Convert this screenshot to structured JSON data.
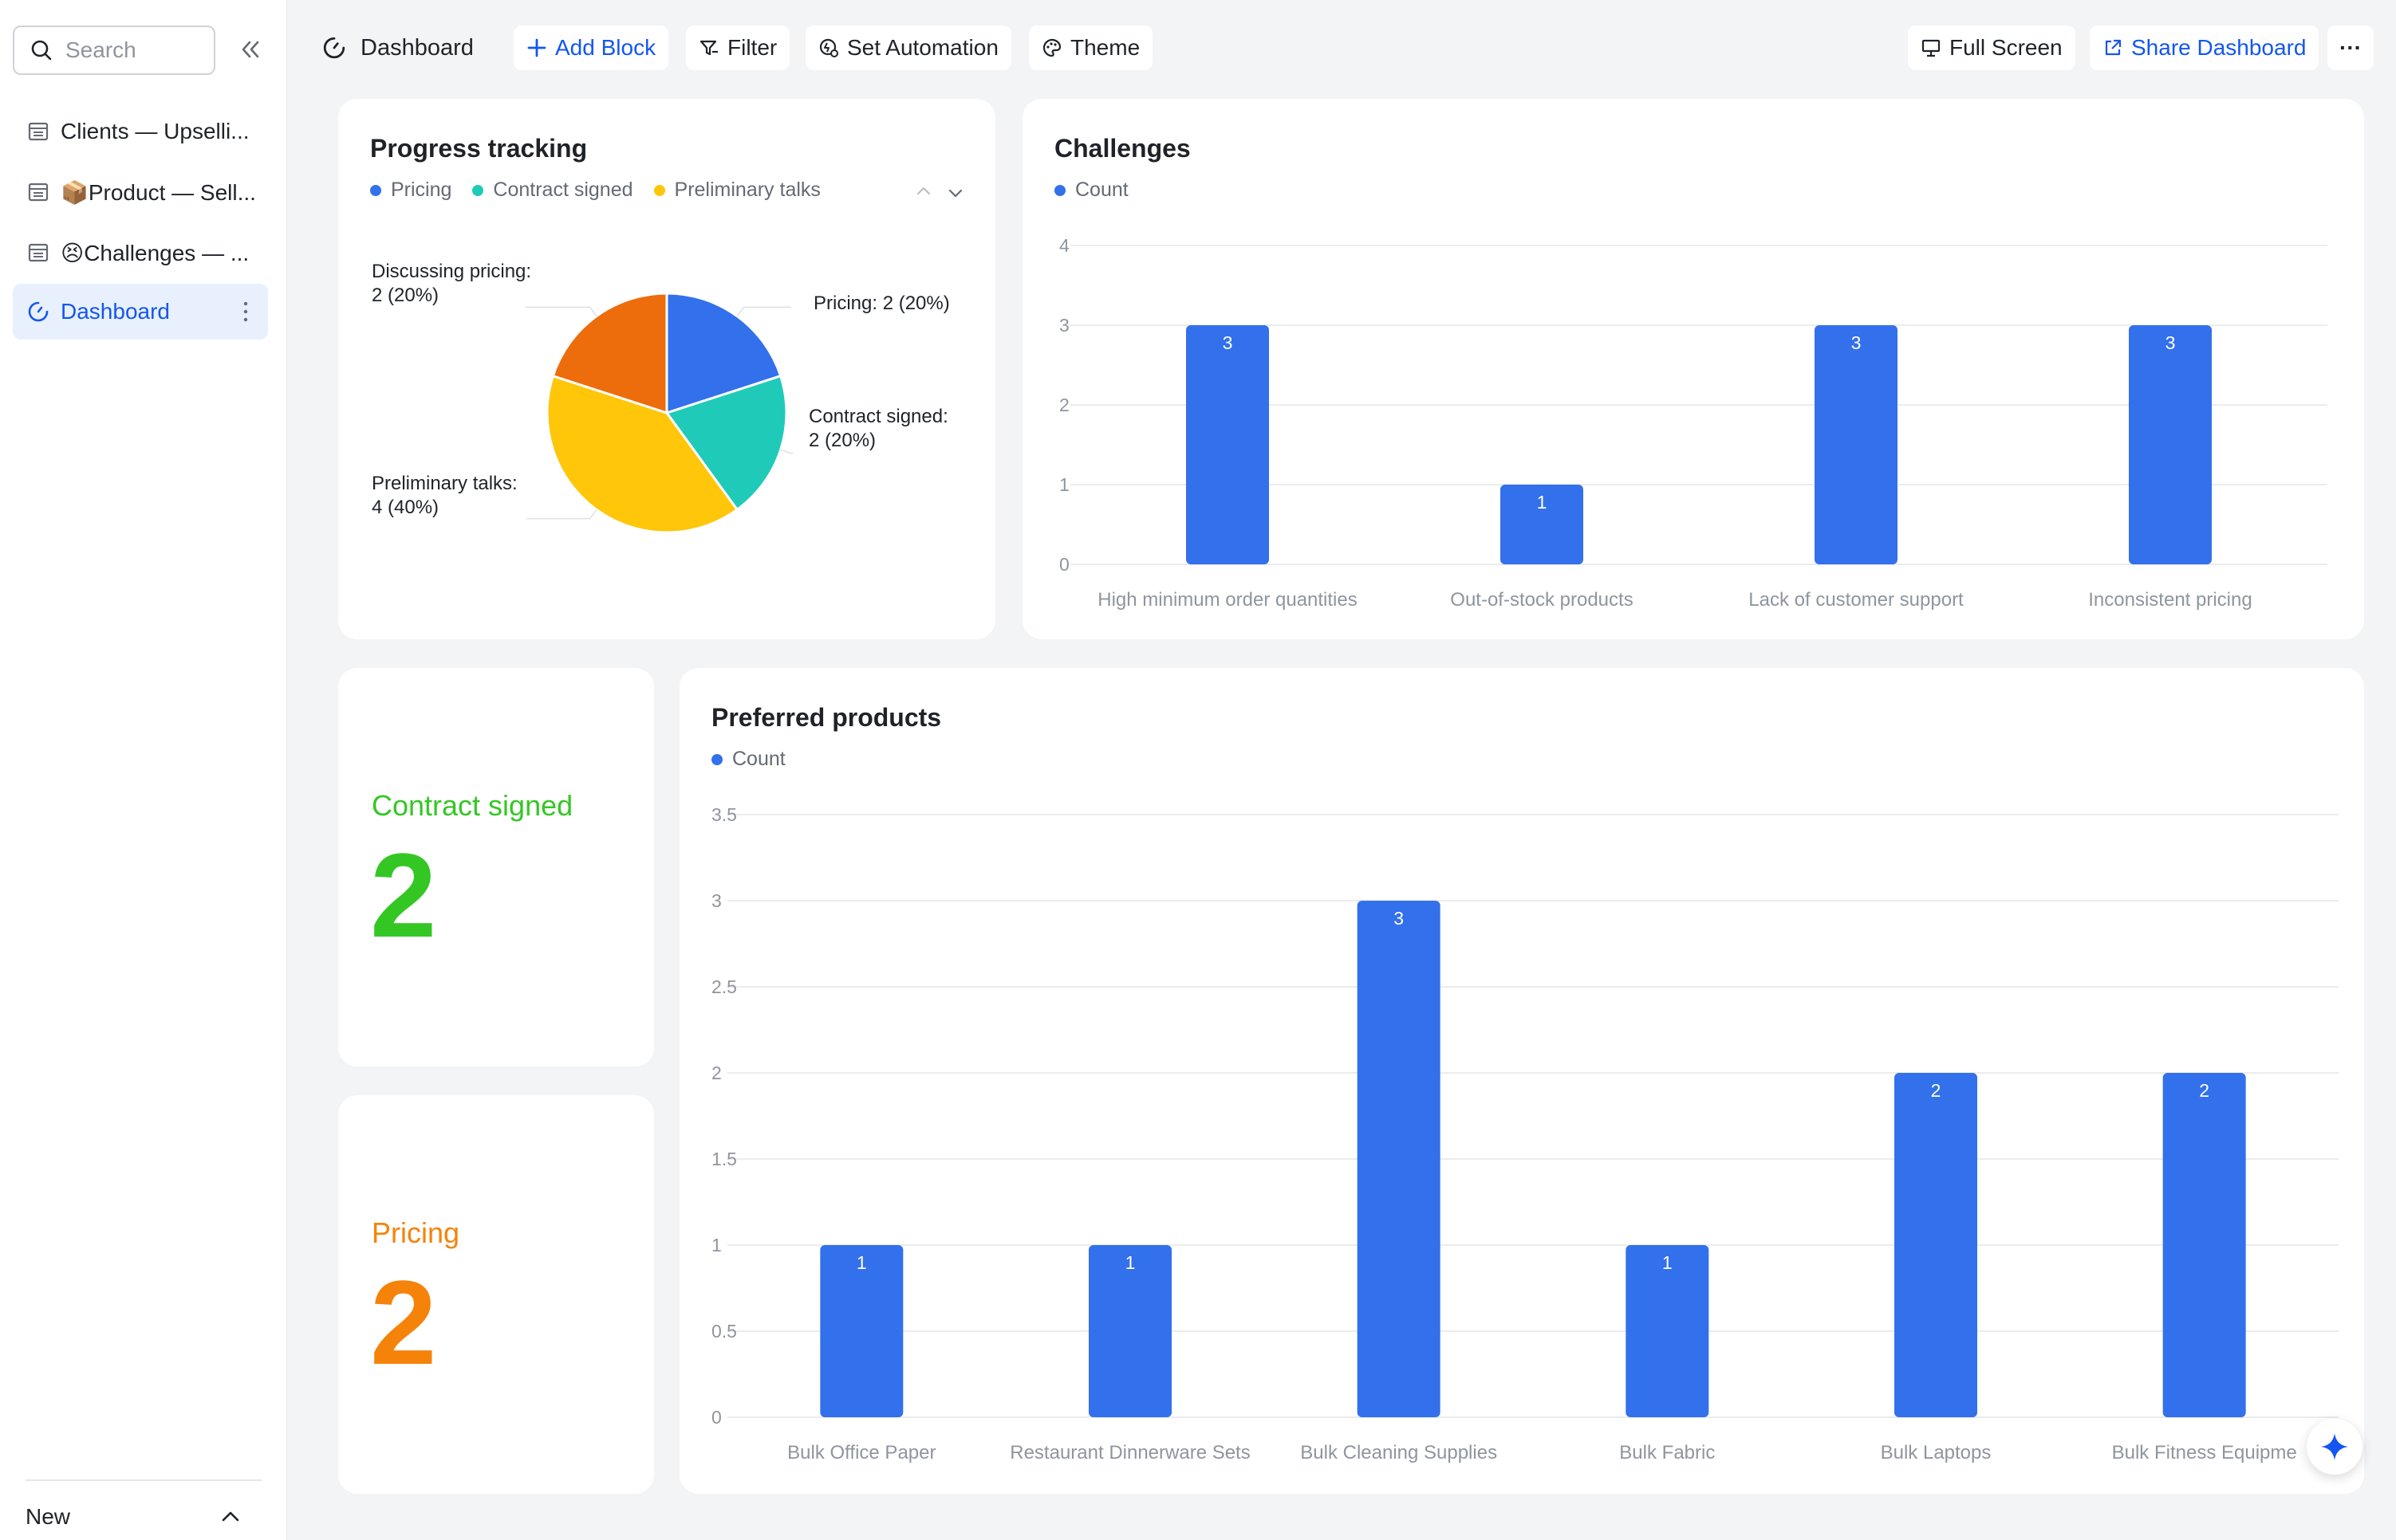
{
  "sidebar": {
    "search_placeholder": "Search",
    "items": [
      {
        "label": "Clients — Upselli..."
      },
      {
        "label": "📦Product — Sell..."
      },
      {
        "label": "😣Challenges — ..."
      },
      {
        "label": "Dashboard"
      }
    ],
    "footer_label": "New"
  },
  "toolbar": {
    "title": "Dashboard",
    "add_block": "Add Block",
    "filter": "Filter",
    "set_automation": "Set Automation",
    "theme": "Theme",
    "full_screen": "Full Screen",
    "share_dashboard": "Share Dashboard",
    "more": "···"
  },
  "colors": {
    "accent": "#1456f0",
    "bar": "#3370eb",
    "pricing": "#3370eb",
    "contract_signed": "#1fcbb8",
    "preliminary_talks": "#ffc60a",
    "discussing_pricing": "#ed6d0c",
    "kpi_green": "#34c724",
    "kpi_orange": "#f5830a"
  },
  "progress_tracking": {
    "title": "Progress tracking",
    "legend": [
      "Pricing",
      "Contract signed",
      "Preliminary talks"
    ]
  },
  "challenges": {
    "title": "Challenges",
    "legend": [
      "Count"
    ]
  },
  "kpi_contract": {
    "label": "Contract signed",
    "value": "2"
  },
  "kpi_pricing": {
    "label": "Pricing",
    "value": "2"
  },
  "preferred_products": {
    "title": "Preferred products",
    "legend": [
      "Count"
    ]
  },
  "chart_data": [
    {
      "type": "pie",
      "title": "Progress tracking",
      "slices": [
        {
          "name": "Pricing",
          "value": 2,
          "label": "Pricing: 2 (20%)",
          "color": "#3370eb"
        },
        {
          "name": "Contract signed",
          "value": 2,
          "label": "Contract signed: 2 (20%)",
          "color": "#1fcbb8"
        },
        {
          "name": "Preliminary talks",
          "value": 4,
          "label": "Preliminary talks: 4 (40%)",
          "color": "#ffc60a"
        },
        {
          "name": "Discussing pricing",
          "value": 2,
          "label": "Discussing pricing: 2 (20%)",
          "color": "#ed6d0c"
        }
      ]
    },
    {
      "type": "bar",
      "title": "Challenges",
      "categories": [
        "High minimum order quantities",
        "Out-of-stock products",
        "Lack of customer support",
        "Inconsistent pricing"
      ],
      "series": [
        {
          "name": "Count",
          "values": [
            3,
            1,
            3,
            3
          ]
        }
      ],
      "ylim": [
        0,
        4
      ],
      "yticks": [
        "0",
        "1",
        "2",
        "3",
        "4"
      ],
      "grid": true
    },
    {
      "type": "bar",
      "title": "Preferred products",
      "categories": [
        "Bulk Office Paper",
        "Restaurant Dinnerware Sets",
        "Bulk Cleaning Supplies",
        "Bulk Fabric",
        "Bulk Laptops",
        "Bulk Fitness Equipme"
      ],
      "series": [
        {
          "name": "Count",
          "values": [
            1,
            1,
            3,
            1,
            2,
            2
          ]
        }
      ],
      "ylim": [
        0,
        3.5
      ],
      "yticks": [
        "0",
        "0.5",
        "1",
        "1.5",
        "2",
        "2.5",
        "3",
        "3.5"
      ],
      "grid": true
    }
  ]
}
